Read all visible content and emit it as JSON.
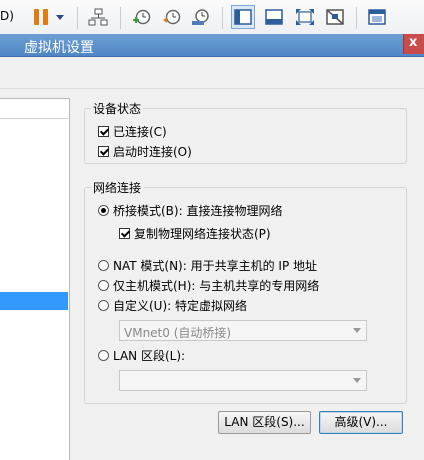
{
  "toolbar": {
    "partial_text": "D)",
    "icons": [
      "pause-icon",
      "dropdown-arrow-icon",
      "network-icon",
      "snapshot-take-icon",
      "snapshot-revert-icon",
      "snapshot-manager-icon",
      "library-view-icon",
      "console-view-icon",
      "fullscreen-icon",
      "unity-icon",
      "settings-view-icon"
    ]
  },
  "window": {
    "title": "虚拟机设置",
    "close_label": "x"
  },
  "device_status": {
    "title": "设备状态",
    "connected": {
      "label": "已连接(C)",
      "checked": true
    },
    "connect_on_power_on": {
      "label": "启动时连接(O)",
      "checked": true
    }
  },
  "network": {
    "title": "网络连接",
    "bridged": {
      "label": "桥接模式(B): 直接连接物理网络",
      "selected": true
    },
    "replicate": {
      "label": "复制物理网络连接状态(P)",
      "checked": true
    },
    "nat": {
      "label": "NAT 模式(N): 用于共享主机的 IP 地址",
      "selected": false
    },
    "host_only": {
      "label": "仅主机模式(H): 与主机共享的专用网络",
      "selected": false
    },
    "custom": {
      "label": "自定义(U): 特定虚拟网络",
      "selected": false
    },
    "custom_combo_value": "VMnet0 (自动桥接)",
    "lan_segment": {
      "label": "LAN 区段(L):",
      "selected": false
    },
    "lan_combo_value": ""
  },
  "buttons": {
    "lan_segments": "LAN 区段(S)...",
    "advanced": "高级(V)..."
  },
  "colors": {
    "accent": "#3399ff",
    "titlebar": "#5a8fcc",
    "pause": "#e07a12"
  }
}
